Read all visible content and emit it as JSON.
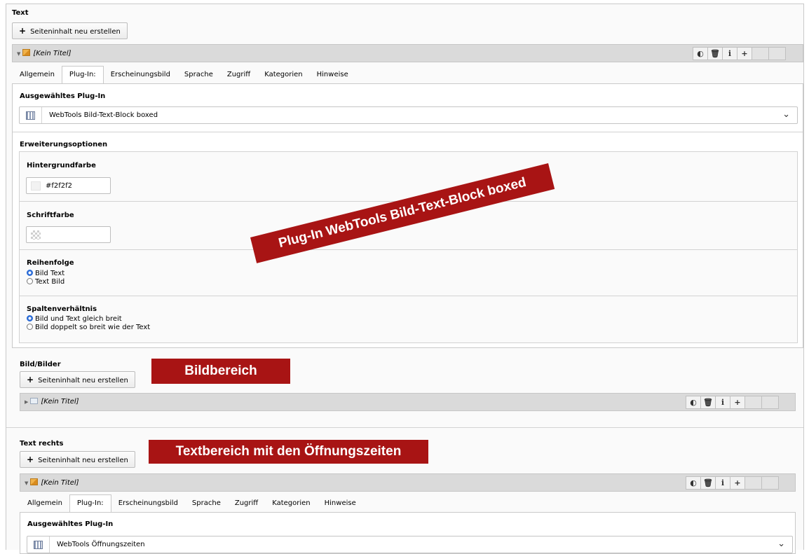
{
  "section1": {
    "heading": "Text",
    "new_btn": "Seiteninhalt neu erstellen",
    "element_title": "[Kein Titel]",
    "tabs": [
      "Allgemein",
      "Plug-In:",
      "Erscheinungsbild",
      "Sprache",
      "Zugriff",
      "Kategorien",
      "Hinweise"
    ],
    "active_tab": "Plug-In:",
    "plugin_label": "Ausgewähltes Plug-In",
    "plugin_value": "WebTools Bild-Text-Block boxed",
    "ext_label": "Erweiterungsoptionen",
    "bg_label": "Hintergrundfarbe",
    "bg_value": "#f2f2f2",
    "font_color_label": "Schriftfarbe",
    "font_color_value": "",
    "order_label": "Reihenfolge",
    "order_options": [
      "Bild Text",
      "Text Bild"
    ],
    "ratio_label": "Spaltenverhältnis",
    "ratio_options": [
      "Bild und Text gleich breit",
      "Bild doppelt so breit wie der Text"
    ]
  },
  "section2": {
    "heading": "Bild/Bilder",
    "new_btn": "Seiteninhalt neu erstellen",
    "element_title": "[Kein Titel]"
  },
  "section3": {
    "heading": "Text rechts",
    "new_btn": "Seiteninhalt neu erstellen",
    "element_title": "[Kein Titel]",
    "tabs": [
      "Allgemein",
      "Plug-In:",
      "Erscheinungsbild",
      "Sprache",
      "Zugriff",
      "Kategorien",
      "Hinweise"
    ],
    "plugin_label": "Ausgewähltes Plug-In",
    "plugin_value": "WebTools Öffnungszeiten"
  },
  "callouts": {
    "plugin": "Plug-In WebTools Bild-Text-Block boxed",
    "image_area": "Bildbereich",
    "text_area": "Textbereich mit den Öffnungszeiten"
  },
  "controls": {
    "toggle_icon": "toggle-icon",
    "delete_icon": "trash-icon",
    "info_icon": "info-icon",
    "add_icon": "plus-icon"
  },
  "colors": {
    "callout_red": "#a81414",
    "radio_blue": "#2a6bd6",
    "swatch_bg": "#f2f2f2"
  }
}
